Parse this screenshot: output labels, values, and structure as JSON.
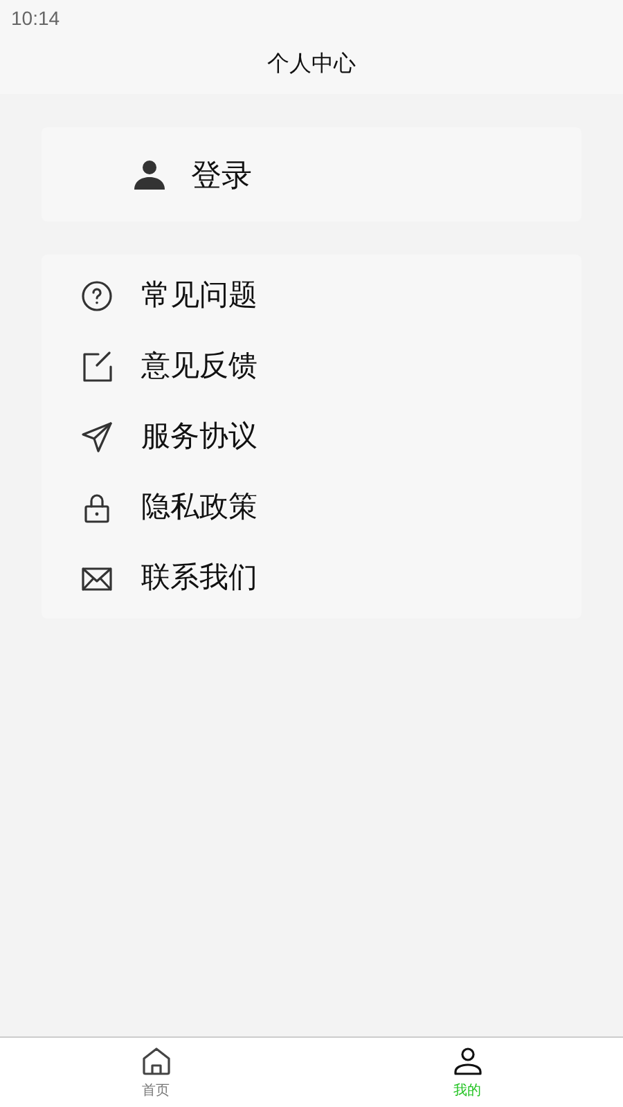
{
  "status_bar": {
    "time": "10:14"
  },
  "header": {
    "title": "个人中心"
  },
  "login": {
    "label": "登录"
  },
  "menu": [
    {
      "label": "常见问题"
    },
    {
      "label": "意见反馈"
    },
    {
      "label": "服务协议"
    },
    {
      "label": "隐私政策"
    },
    {
      "label": "联系我们"
    }
  ],
  "tab_bar": [
    {
      "label": "首页",
      "selected": false
    },
    {
      "label": "我的",
      "selected": true
    }
  ]
}
